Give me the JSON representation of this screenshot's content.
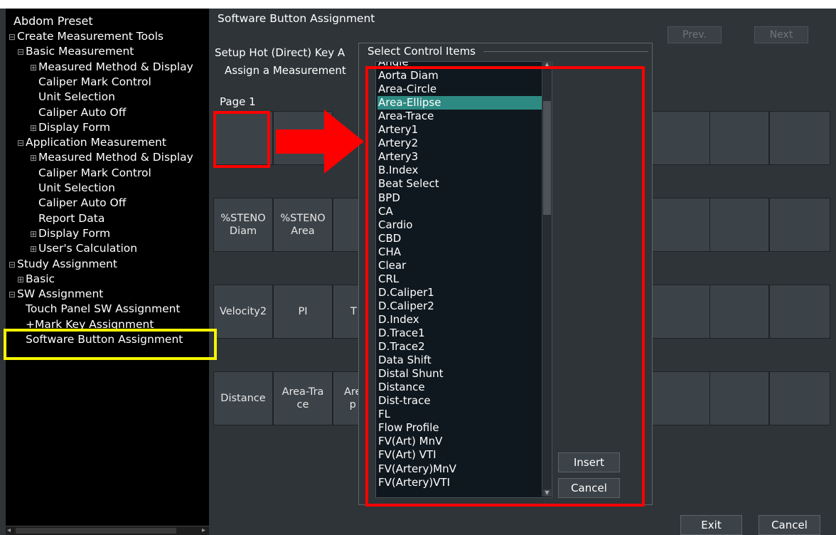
{
  "tree": {
    "title": "Abdom Preset",
    "items": [
      {
        "label": "Create Measurement Tools",
        "mark": "⊟"
      },
      {
        "label": "Basic Measurement",
        "mark": "⊟"
      },
      {
        "label": "Measured Method & Display",
        "mark": "⊞"
      },
      {
        "label": "Caliper Mark Control",
        "mark": ""
      },
      {
        "label": "Unit Selection",
        "mark": ""
      },
      {
        "label": "Caliper Auto Off",
        "mark": ""
      },
      {
        "label": "Display Form",
        "mark": "⊞"
      },
      {
        "label": "Application Measurement",
        "mark": "⊟"
      },
      {
        "label": "Measured Method & Display",
        "mark": "⊞"
      },
      {
        "label": "Caliper Mark Control",
        "mark": ""
      },
      {
        "label": "Unit Selection",
        "mark": ""
      },
      {
        "label": "Caliper Auto Off",
        "mark": ""
      },
      {
        "label": "Report Data",
        "mark": ""
      },
      {
        "label": "Display Form",
        "mark": "⊞"
      },
      {
        "label": "User's Calculation",
        "mark": "⊞"
      },
      {
        "label": "Study Assignment",
        "mark": "⊟"
      },
      {
        "label": "Basic",
        "mark": "⊞"
      },
      {
        "label": "SW Assignment",
        "mark": "⊟"
      },
      {
        "label": "Touch Panel SW Assignment",
        "mark": ""
      },
      {
        "label": "+Mark Key Assignment",
        "mark": ""
      },
      {
        "label": "Software Button Assignment",
        "mark": ""
      }
    ]
  },
  "main": {
    "title": "Software Button Assignment",
    "prev_label": "Prev.",
    "next_label": "Next",
    "setup_text": "Setup Hot (Direct) Key A",
    "assign_text": "Assign a Measurement",
    "page_label": "Page 1",
    "row2": [
      "%STENO\nDiam",
      "%STENO\nArea"
    ],
    "row3": [
      "Velocity2",
      "PI",
      "T"
    ],
    "row4": [
      "Distance",
      "Area-Tra\nce",
      "Are\np"
    ],
    "exit_label": "Exit",
    "cancel_label": "Cancel"
  },
  "dialog": {
    "title": "Select Control Items",
    "selected": "Area-Ellipse",
    "items": [
      "Angle",
      "Aorta Diam",
      "Area-Circle",
      "Area-Ellipse",
      "Area-Trace",
      "Artery1",
      "Artery2",
      "Artery3",
      "B.Index",
      "Beat Select",
      "BPD",
      "CA",
      "Cardio",
      "CBD",
      "CHA",
      "Clear",
      "CRL",
      "D.Caliper1",
      "D.Caliper2",
      "D.Index",
      "D.Trace1",
      "D.Trace2",
      "Data Shift",
      "Distal Shunt",
      "Distance",
      "Dist-trace",
      "FL",
      "Flow Profile",
      "FV(Art) MnV",
      "FV(Art) VTI",
      "FV(Artery)MnV",
      "FV(Artery)VTI"
    ],
    "insert_label": "Insert",
    "cancel_label": "Cancel"
  },
  "colors": {
    "annotation_red": "#ff0000",
    "annotation_yellow": "#f5f500",
    "selection": "#2d8a82"
  }
}
